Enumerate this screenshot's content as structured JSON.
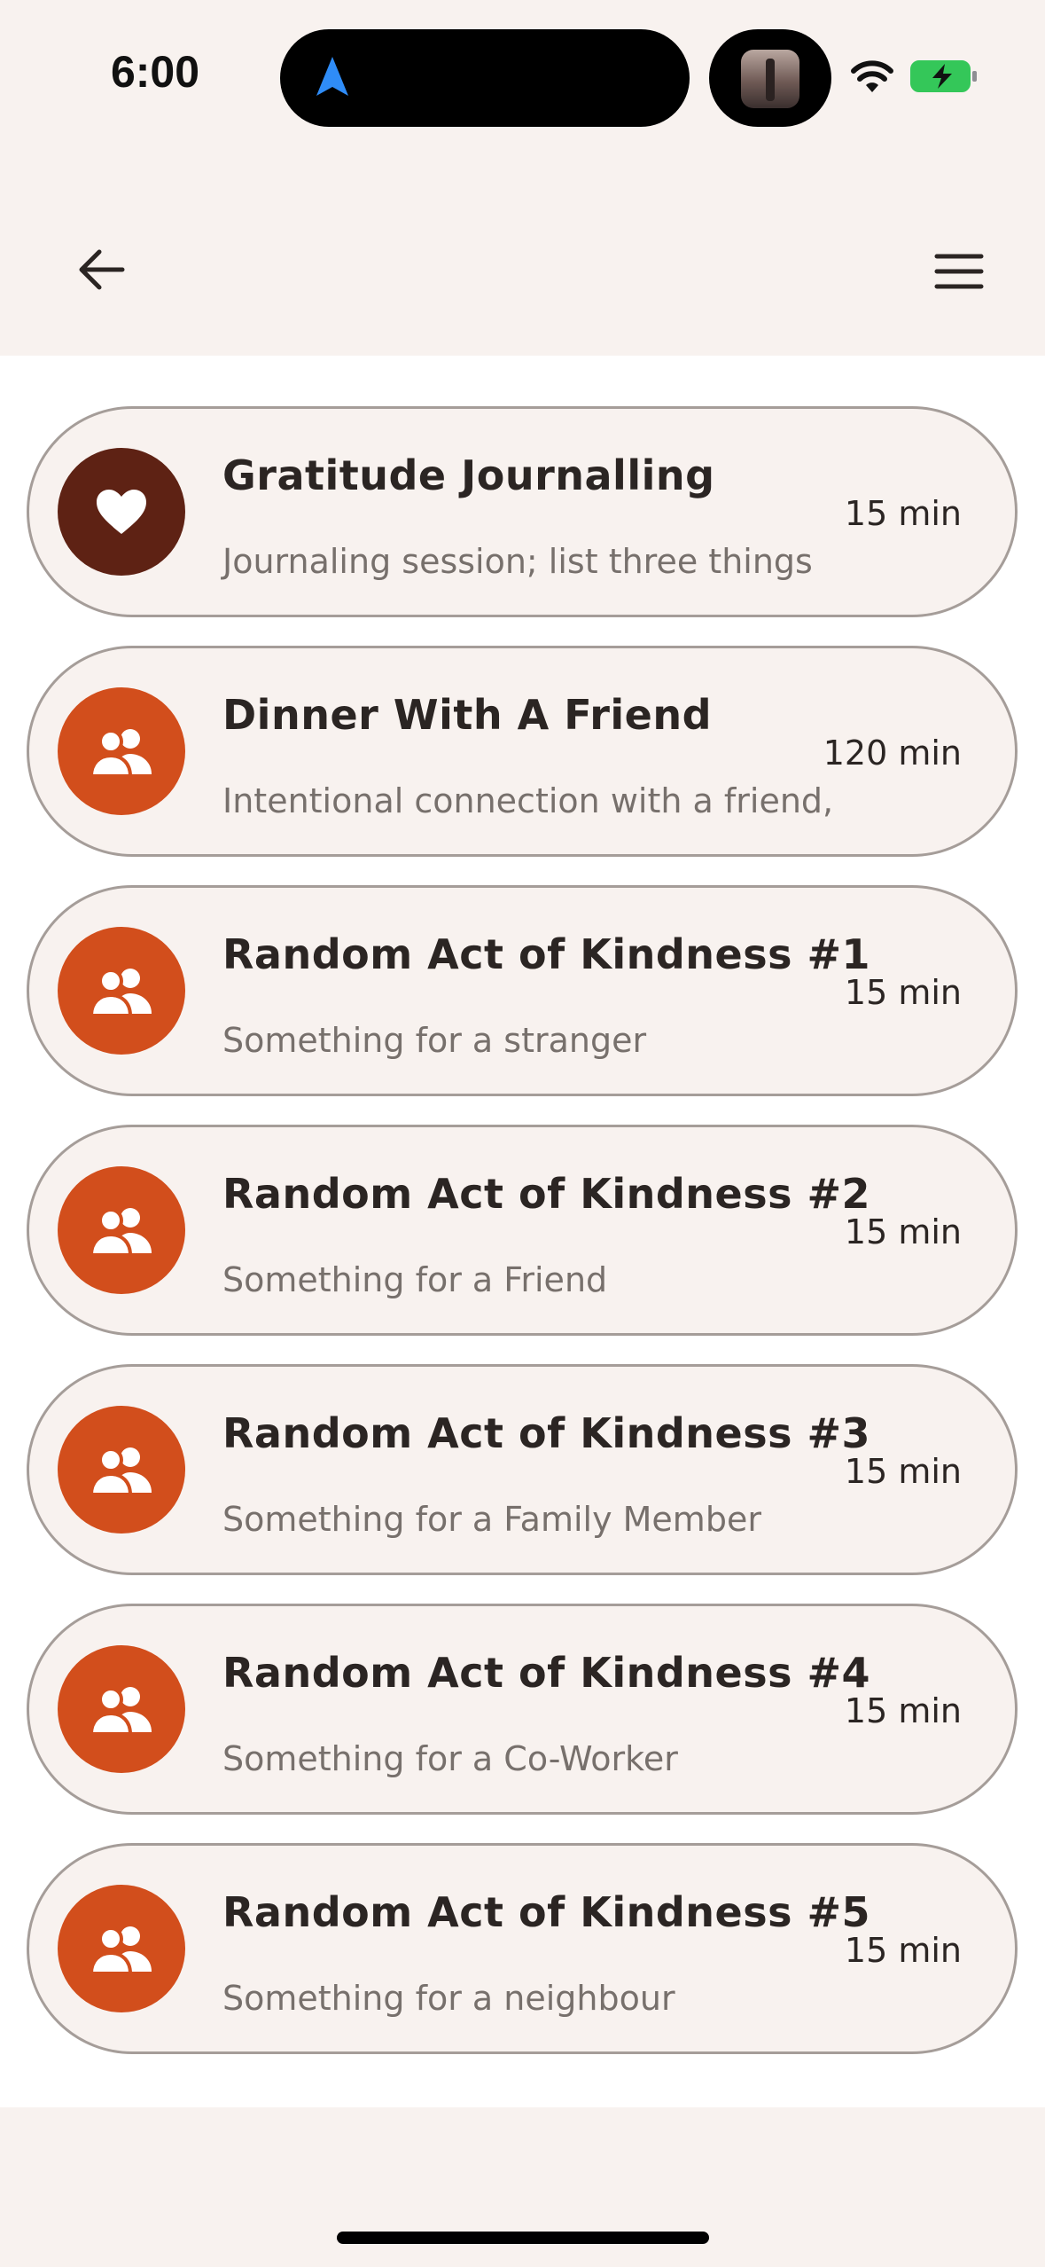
{
  "status_bar": {
    "time": "6:00",
    "icons": [
      "navigation-arrow-icon",
      "media-thumbnail",
      "wifi-icon",
      "battery-charging-icon"
    ]
  },
  "header": {
    "back_icon": "arrow-left-icon",
    "menu_icon": "hamburger-menu-icon"
  },
  "colors": {
    "background": "#f8f2ef",
    "card_border": "#a59d99",
    "icon_dark": "#5e2214",
    "icon_orange": "#d24e1c",
    "title_text": "#2b2523",
    "subtitle_text": "#77706c",
    "battery_green": "#34c759"
  },
  "activities": [
    {
      "title": "Gratitude Journalling",
      "subtitle": "Journaling session; list three things",
      "duration": "15 min",
      "icon": "heart-icon",
      "color": "#5e2214"
    },
    {
      "title": "Dinner With A Friend",
      "subtitle": "Intentional connection with a friend,",
      "duration": "120 min",
      "icon": "people-icon",
      "color": "#d24e1c"
    },
    {
      "title": "Random Act of Kindness #1",
      "subtitle": "Something for a stranger",
      "duration": "15 min",
      "icon": "people-icon",
      "color": "#d24e1c"
    },
    {
      "title": "Random Act of Kindness #2",
      "subtitle": "Something for a Friend",
      "duration": "15 min",
      "icon": "people-icon",
      "color": "#d24e1c"
    },
    {
      "title": "Random Act of Kindness #3",
      "subtitle": "Something for a Family Member",
      "duration": "15 min",
      "icon": "people-icon",
      "color": "#d24e1c"
    },
    {
      "title": "Random Act of Kindness #4",
      "subtitle": "Something for a Co-Worker",
      "duration": "15 min",
      "icon": "people-icon",
      "color": "#d24e1c"
    },
    {
      "title": "Random Act of Kindness #5",
      "subtitle": "Something for a neighbour",
      "duration": "15 min",
      "icon": "people-icon",
      "color": "#d24e1c"
    }
  ]
}
